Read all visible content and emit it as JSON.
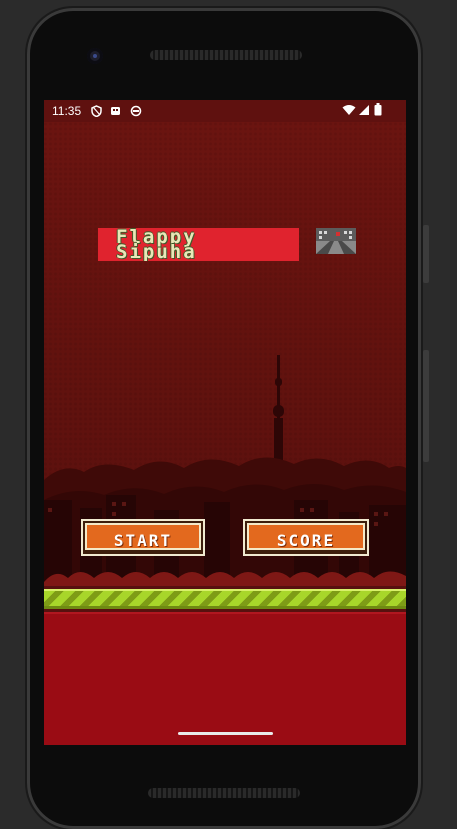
{
  "status_bar": {
    "time": "11:35",
    "left_icons": [
      "shield-icon",
      "sim-card-icon",
      "android-icon"
    ],
    "right_icons": [
      "wifi-icon",
      "signal-icon",
      "battery-icon"
    ]
  },
  "game": {
    "title_line1": "Flappy",
    "title_line2": "Sipuha",
    "buttons": {
      "start_label": "START",
      "score_label": "SCORE"
    }
  },
  "colors": {
    "sky": "#5f110f",
    "title_banner": "#e0232e",
    "button_fill": "#e3691e",
    "hazard_stripe": "#a8d62a",
    "ground": "#9a0c14"
  }
}
